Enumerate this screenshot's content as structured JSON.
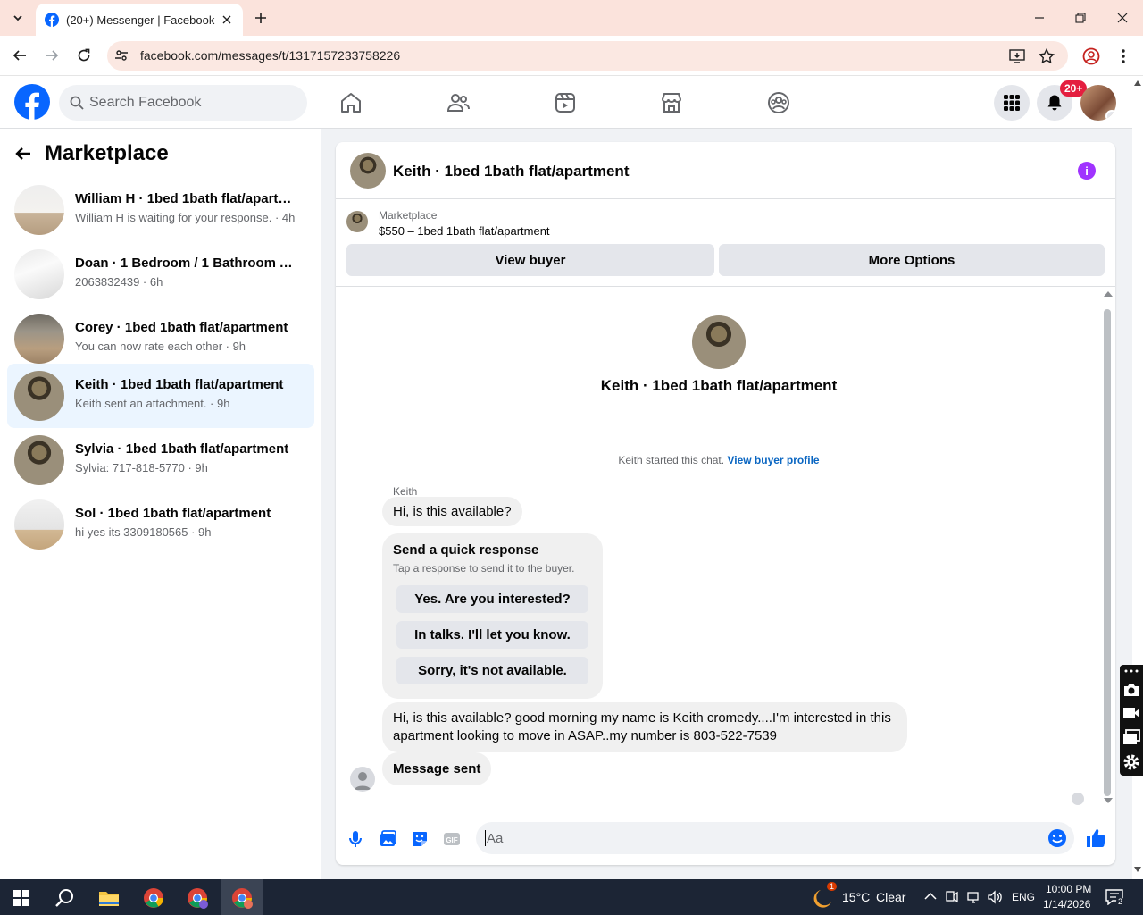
{
  "browser": {
    "tab_title": "(20+) Messenger | Facebook",
    "url": "facebook.com/messages/t/1317157233758226"
  },
  "fb_header": {
    "search_placeholder": "Search Facebook",
    "notification_badge": "20+"
  },
  "left_panel": {
    "title": "Marketplace",
    "conversations": [
      {
        "name": "William H · 1bed 1bath flat/apartm...",
        "sub": "William H is waiting for your response. · 4h",
        "active": false
      },
      {
        "name": "Doan · 1 Bedroom / 1 Bathroom A...",
        "sub": "2063832439 · 6h",
        "active": false
      },
      {
        "name": "Corey · 1bed 1bath flat/apartment",
        "sub": "You can now rate each other · 9h",
        "active": false
      },
      {
        "name": "Keith · 1bed 1bath flat/apartment",
        "sub": "Keith sent an attachment. · 9h",
        "active": true
      },
      {
        "name": "Sylvia · 1bed 1bath flat/apartment",
        "sub": "Sylvia: 717-818-5770 · 9h",
        "active": false
      },
      {
        "name": "Sol · 1bed 1bath flat/apartment",
        "sub": "hi yes its 3309180565 · 9h",
        "active": false
      }
    ]
  },
  "chat": {
    "title": "Keith · 1bed 1bath flat/apartment",
    "marketplace_label": "Marketplace",
    "listing": "$550 – 1bed 1bath flat/apartment",
    "view_buyer": "View buyer",
    "more_options": "More Options",
    "intro_name": "Keith · 1bed 1bath flat/apartment",
    "started_text": "Keith started this chat.",
    "view_buyer_profile": "View buyer profile",
    "sender": "Keith",
    "msg1": "Hi, is this available?",
    "quick_response": {
      "heading": "Send a quick response",
      "sub": "Tap a response to send it to the buyer.",
      "options": [
        "Yes. Are you interested?",
        "In talks. I'll let you know.",
        "Sorry, it's not available."
      ]
    },
    "msg2": "Hi, is this available? good morning my name is Keith cromedy....I'm interested in this apartment looking to move in ASAP..my number is 803-522-7539",
    "msg3": "Message sent",
    "composer_placeholder": "Aa"
  },
  "taskbar": {
    "weather_temp": "15°C",
    "weather_desc": "Clear",
    "weather_badge": "1",
    "lang": "ENG",
    "time": "10:00 PM",
    "date": "1/14/2026",
    "notif_count": "2"
  },
  "colors": {
    "fb_blue": "#0866ff",
    "accent_purple": "#a033ff",
    "badge_red": "#e41e3f",
    "active_row": "#ebf5ff"
  }
}
